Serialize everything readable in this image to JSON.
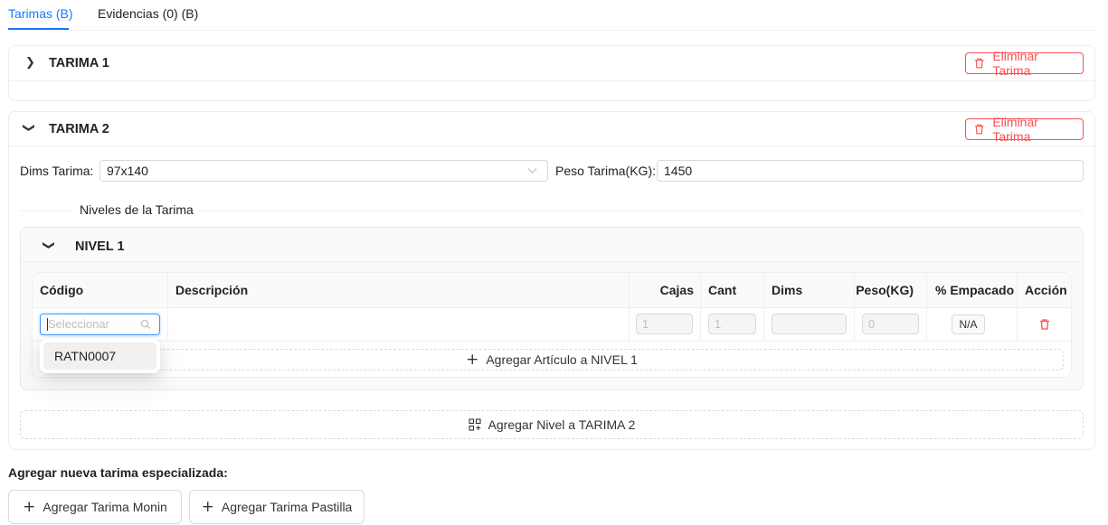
{
  "tabs": [
    {
      "label": "Tarimas (B)",
      "active": true
    },
    {
      "label": "Evidencias (0) (B)",
      "active": false
    }
  ],
  "tarimas": [
    {
      "title": "TARIMA 1",
      "delete_label": "Eliminar Tarima",
      "expanded": false
    },
    {
      "title": "TARIMA 2",
      "delete_label": "Eliminar Tarima",
      "expanded": true,
      "dims_label": "Dims Tarima",
      "dims_value": "97x140",
      "peso_label": "Peso Tarima(KG)",
      "peso_value": "1450",
      "niveles_divider": "Niveles de la Tarima",
      "nivel": {
        "title": "NIVEL 1",
        "columns": [
          "Código",
          "Descripción",
          "Cajas",
          "Cant",
          "Dims",
          "Peso(KG)",
          "% Empacado",
          "Acción"
        ],
        "row": {
          "codigo_placeholder": "Seleccionar",
          "cajas": "1",
          "cant": "1",
          "dims": "",
          "peso": "0",
          "empacado": "N/A"
        },
        "dropdown_options": [
          "RATN0007"
        ],
        "add_article_label": "Agregar Artículo a NIVEL 1"
      },
      "add_level_label": "Agregar Nivel a TARIMA 2"
    }
  ],
  "special": {
    "heading": "Agregar nueva tarima especializada:",
    "buttons": [
      "Agregar Tarima Monin",
      "Agregar Tarima Pastilla"
    ]
  },
  "colors": {
    "primary": "#1677ff",
    "danger": "#ff4d4f"
  }
}
